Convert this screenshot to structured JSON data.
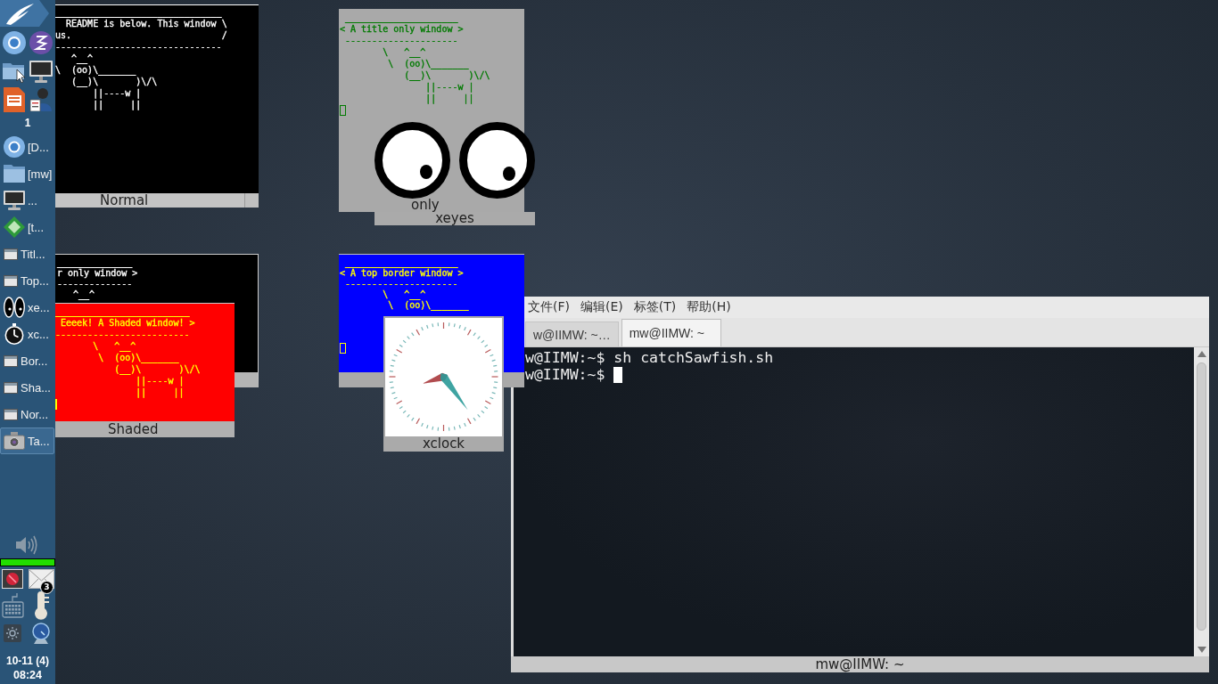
{
  "panel": {
    "desktop_number": "1",
    "tasks": [
      {
        "kind": "ring",
        "label": "[D...",
        "selected": false
      },
      {
        "kind": "folder",
        "label": "[mw]",
        "selected": false
      },
      {
        "kind": "monitor",
        "label": "...",
        "selected": false
      },
      {
        "kind": "diamond",
        "label": "[t...",
        "selected": false
      },
      {
        "kind": "window",
        "label": "Titl...",
        "selected": false
      },
      {
        "kind": "window",
        "label": "Top...",
        "selected": false
      },
      {
        "kind": "eyes",
        "label": "xe...",
        "selected": false
      },
      {
        "kind": "clock",
        "label": "xc...",
        "selected": false
      },
      {
        "kind": "window",
        "label": "Bor...",
        "selected": false
      },
      {
        "kind": "window",
        "label": "Sha...",
        "selected": false
      },
      {
        "kind": "window",
        "label": "Nor...",
        "selected": false
      },
      {
        "kind": "camera",
        "label": "Ta...",
        "selected": true
      }
    ],
    "volume": {
      "level": 1
    },
    "mail_count": "3",
    "date": "10-11 (4)",
    "time": "08:24"
  },
  "normal_window": {
    "title": "Normal",
    "lines": [
      "_______________________________",
      "  README is below. This window \\",
      "us.                            /",
      "-------------------------------",
      "   ^__^",
      "\\  (oo)\\_______",
      "   (__)\\       )\\/\\",
      "       ||----w |",
      "       ||     ||"
    ]
  },
  "title_only_window": {
    "title": "only",
    "lines": [
      " _____________________",
      "< A title only window >",
      " ---------------------",
      "        \\   ^__^",
      "         \\  (oo)\\_______",
      "            (__)\\       )\\/\\",
      "                ||----w |",
      "                ||     ||"
    ]
  },
  "xeyes_window": {
    "title": "xeyes"
  },
  "border_window": {
    "lines": [
      "______________",
      "r only window >",
      "--------------",
      "   ^__^"
    ]
  },
  "shaded_window": {
    "title": "Shaded",
    "lines": [
      "_________________________",
      " Eeeek! A Shaded window! >",
      "-------------------------",
      "       \\   ^__^",
      "        \\  (oo)\\_______",
      "           (__)\\       )\\/\\",
      "               ||----w |",
      "               ||     ||"
    ]
  },
  "top_border_window": {
    "lines": [
      " _____________________",
      "< A top border window >",
      " ---------------------",
      "        \\   ^__^",
      "         \\  (oo)\\_______"
    ]
  },
  "xclock_window": {
    "title": "xclock"
  },
  "terminal": {
    "menu": [
      "文件(F)",
      "编辑(E)",
      "标签(T)",
      "帮助(H)"
    ],
    "tabs": [
      {
        "label": "w@IIMW: ~…",
        "selected": false
      },
      {
        "label": "mw@IIMW: ~",
        "selected": true
      }
    ],
    "lines": [
      "w@IIMW:~$ sh catchSawfish.sh",
      "w@IIMW:~$"
    ],
    "title": "mw@IIMW: ~"
  }
}
